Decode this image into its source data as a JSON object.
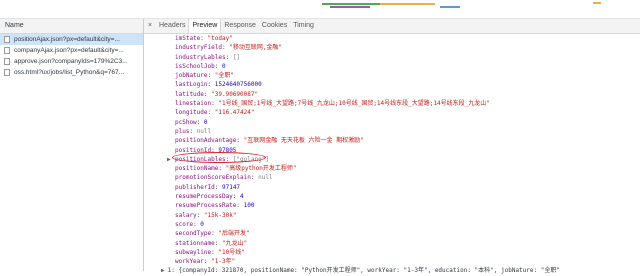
{
  "left_panel": {
    "header": "Name",
    "requests": [
      {
        "name": "positionAjax.json?px=default&city=..."
      },
      {
        "name": "companyAjax.json?px=default&city=..."
      },
      {
        "name": "approve.json?companyIds=179%2C3..."
      },
      {
        "name": "oss.html?ux/jobs/list_Python&q=767..."
      }
    ]
  },
  "tabs": {
    "close": "×",
    "items": [
      "Headers",
      "Preview",
      "Response",
      "Cookies",
      "Timing"
    ],
    "active": "Preview"
  },
  "preview": {
    "properties": [
      {
        "key": "imState",
        "value": "\"today\"",
        "kind": "str"
      },
      {
        "key": "industryField",
        "value": "\"移动互联网,金融\"",
        "kind": "str"
      },
      {
        "key": "industryLables",
        "value": "[]",
        "kind": "nul"
      },
      {
        "key": "isSchoolJob",
        "value": "0",
        "kind": "num"
      },
      {
        "key": "jobNature",
        "value": "\"全职\"",
        "kind": "str"
      },
      {
        "key": "lastLogin",
        "value": "1524640756000",
        "kind": "num"
      },
      {
        "key": "latitude",
        "value": "\"39.90690087\"",
        "kind": "str"
      },
      {
        "key": "linestaion",
        "value": "\"1号线_国贸;1号线_大望路;7号线_九龙山;10号线_国贸;14号线东段_大望路;14号线东段_九龙山\"",
        "kind": "str"
      },
      {
        "key": "longitude",
        "value": "\"116.47424\"",
        "kind": "str"
      },
      {
        "key": "pcShow",
        "value": "0",
        "kind": "num"
      },
      {
        "key": "plus",
        "value": "null",
        "kind": "nul"
      },
      {
        "key": "positionAdvantage",
        "value": "\"互联网金融 无天花板 六险一金 期权激励\"",
        "kind": "str"
      },
      {
        "key": "positionId",
        "value": "97805",
        "kind": "num"
      },
      {
        "key": "positionLables",
        "value": "[\"golang\"]",
        "kind": "nul",
        "arrow": "▶"
      },
      {
        "key": "positionName",
        "value": "\"高级python开发工程师\"",
        "kind": "str"
      },
      {
        "key": "promotionScoreExplain",
        "value": "null",
        "kind": "nul"
      },
      {
        "key": "publisherId",
        "value": "97147",
        "kind": "num"
      },
      {
        "key": "resumeProcessDay",
        "value": "4",
        "kind": "num"
      },
      {
        "key": "resumeProcessRate",
        "value": "100",
        "kind": "num"
      },
      {
        "key": "salary",
        "value": "\"15k-30k\"",
        "kind": "str"
      },
      {
        "key": "score",
        "value": "0",
        "kind": "num"
      },
      {
        "key": "secondType",
        "value": "\"后端开发\"",
        "kind": "str"
      },
      {
        "key": "stationname",
        "value": "\"九龙山\"",
        "kind": "str"
      },
      {
        "key": "subwayline",
        "value": "\"10号线\"",
        "kind": "str"
      },
      {
        "key": "workYear",
        "value": "\"1-3年\"",
        "kind": "str"
      }
    ],
    "collapsed_item": {
      "arrow": "▶",
      "text": "1: {companyId: 321870, positionName: \"Python开发工程师\", workYear: \"1-3年\", education: \"本科\", jobNature: \"全职\""
    }
  },
  "colors": {
    "key": "#881280",
    "string": "#c41a16",
    "number": "#1c00cf",
    "highlight": "#d9252a",
    "selected_row": "#cfe3f9"
  }
}
